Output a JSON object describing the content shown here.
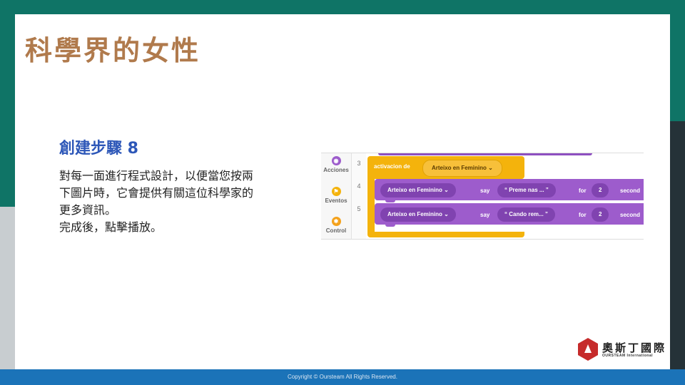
{
  "slide": {
    "title": "科學界的女性",
    "step_title": "創建步驟 8",
    "description_lines": [
      "對每一面進行程式設計，以便當您按兩",
      "下圖片時，它會提供有關這位科學家的",
      "更多資訊。",
      "完成後，點擊播放。"
    ]
  },
  "editor": {
    "categories": [
      {
        "label": "Acciones",
        "icon": "actions-icon",
        "color": "#9d5ccc"
      },
      {
        "label": "Eventos",
        "icon": "flag-icon",
        "color": "#f4b30c"
      },
      {
        "label": "Control",
        "icon": "control-icon",
        "color": "#f4a21c"
      }
    ],
    "line_numbers": [
      "3",
      "4",
      "5"
    ],
    "event_block": {
      "label": "activacion de",
      "target": "Arteixo en Feminino ⌄"
    },
    "say_blocks": [
      {
        "actor": "Arteixo en Feminino ⌄",
        "verb": "say",
        "text": "“ Preme nas ... ”",
        "for": "for",
        "seconds": "2",
        "unit": "second"
      },
      {
        "actor": "Arteixo en Feminino ⌄",
        "verb": "say",
        "text": "“ Cando rem... ”",
        "for": "for",
        "seconds": "2",
        "unit": "second"
      }
    ]
  },
  "logo": {
    "chinese": "奧斯丁國際",
    "english": "OURSTEAM International"
  },
  "footer": {
    "copyright": "Copyright © Oursteam All Rights Reserved."
  }
}
